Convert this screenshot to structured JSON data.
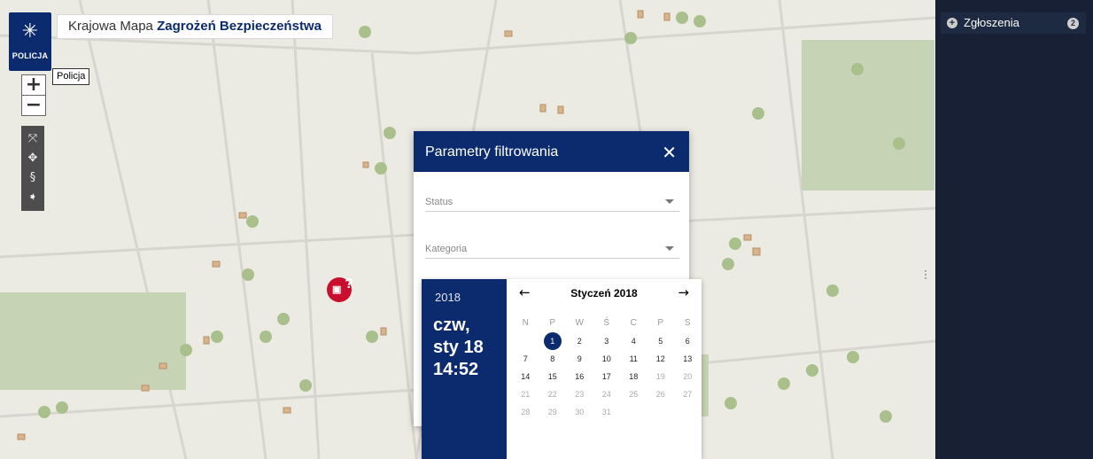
{
  "header": {
    "title_plain": "Krajowa Mapa",
    "title_bold": "Zagrożeń Bezpieczeństwa",
    "logo_text": "POLICJA",
    "tooltip": "Policja"
  },
  "map_controls": {
    "zoom_in": "+",
    "zoom_out": "−",
    "tools": [
      "fullscreen-icon",
      "locate-icon",
      "legal-icon",
      "tag-icon"
    ]
  },
  "sidebar": {
    "label": "Zgłoszenia",
    "badge": "2"
  },
  "filter_modal": {
    "title": "Parametry filtrowania",
    "close": "✕",
    "fields": [
      {
        "label": "Status"
      },
      {
        "label": "Kategoria"
      }
    ]
  },
  "calendar": {
    "year": "2018",
    "day_short": "czw,",
    "date_short": "sty 18",
    "time": "14:52",
    "month_label": "Styczeń 2018",
    "prev": "←",
    "next": "→",
    "weekdays": [
      "N",
      "P",
      "W",
      "Ś",
      "C",
      "P",
      "S"
    ],
    "weeks": [
      [
        "",
        "1",
        "2",
        "3",
        "4",
        "5",
        "6"
      ],
      [
        "7",
        "8",
        "9",
        "10",
        "11",
        "12",
        "13"
      ],
      [
        "14",
        "15",
        "16",
        "17",
        "18",
        "19",
        "20"
      ],
      [
        "21",
        "22",
        "23",
        "24",
        "25",
        "26",
        "27"
      ],
      [
        "28",
        "29",
        "30",
        "31",
        "",
        "",
        ""
      ]
    ],
    "selected_day": "1"
  },
  "colors": {
    "navy": "#0b2b6e",
    "sidebar": "#172034",
    "marker": "#c8102e",
    "map_bg": "#ecebe3"
  }
}
